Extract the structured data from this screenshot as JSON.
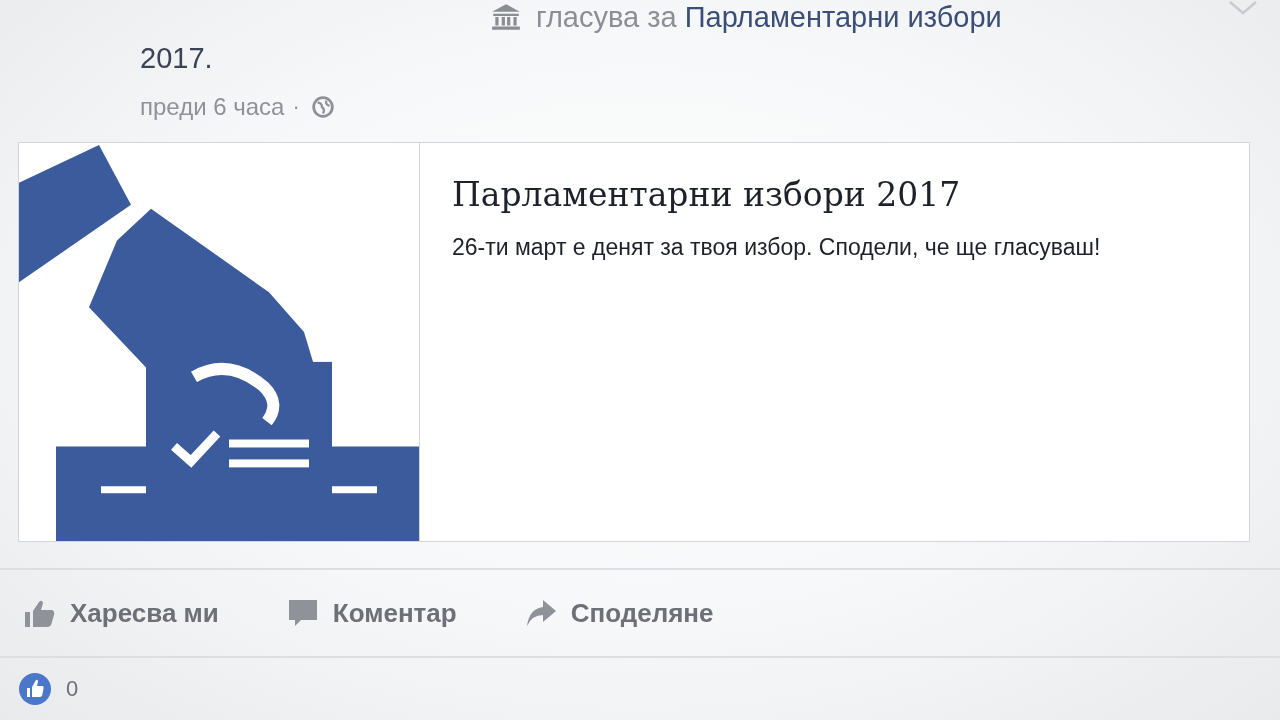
{
  "post": {
    "activity": "гласува за **Парламентарни избори**",
    "activity_end": "2017.",
    "time": "преди 6 часа",
    "separator": "·"
  },
  "link_card": {
    "title": "Парламентарни избори 2017",
    "description": "26-ти март е денят за твоя избор. Сподели, че ще гласуваш!"
  },
  "actions": [
    {
      "kind": "like",
      "label": "Харесва ми"
    },
    {
      "kind": "comment",
      "label": "Коментар"
    },
    {
      "kind": "share",
      "label": "Споделяне"
    }
  ],
  "reactions": {
    "count": "0"
  }
}
